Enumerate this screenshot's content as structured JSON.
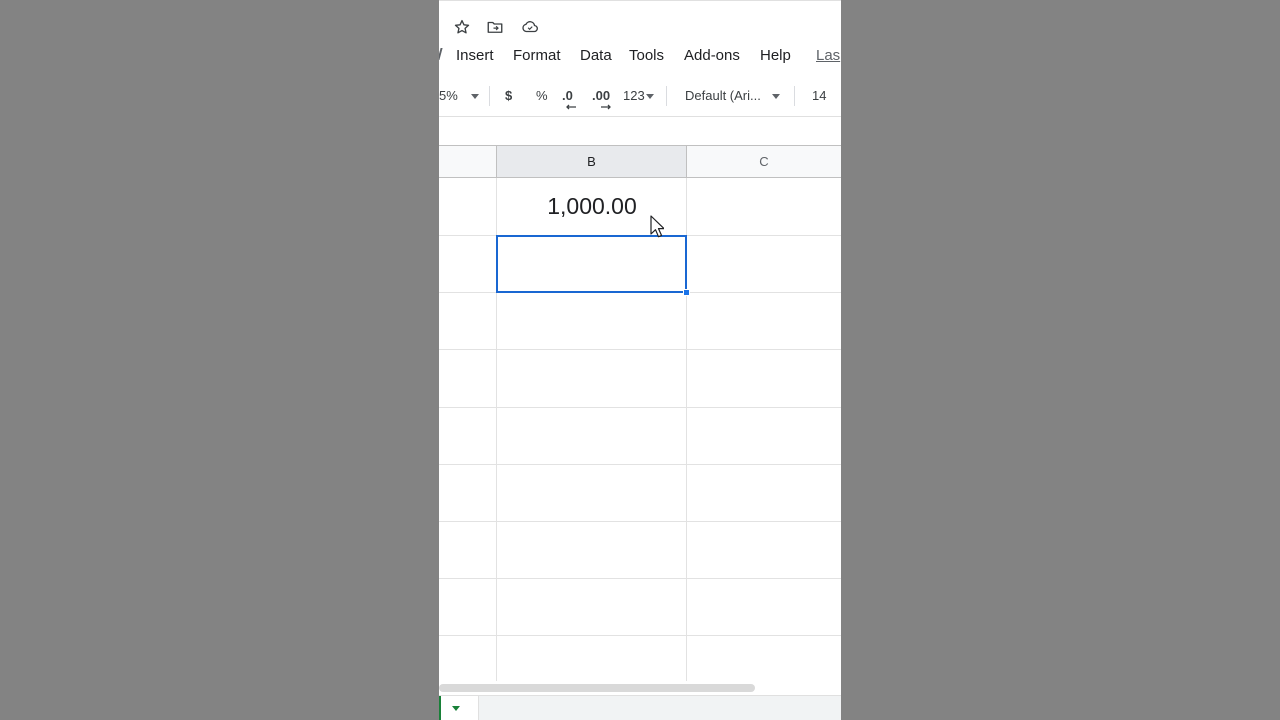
{
  "menubar": {
    "items": [
      "Insert",
      "Format",
      "Data",
      "Tools",
      "Add-ons",
      "Help"
    ],
    "last_edit_label": "Las"
  },
  "title_icons": [
    "star-icon",
    "move-to-folder-icon",
    "cloud-saved-icon"
  ],
  "toolbar": {
    "zoom": "5%",
    "currency": "$",
    "percent": "%",
    "decrease_decimals": ".0",
    "increase_decimals": ".00",
    "more_formats": "123",
    "font": "Default (Ari...",
    "font_size": "14"
  },
  "grid": {
    "columns": [
      "B",
      "C"
    ],
    "active_column": "B",
    "cells": {
      "B1": "1,000.00"
    }
  },
  "colors": {
    "selection": "#1a73e8",
    "sheet_tab_accent": "#188038",
    "background": "#838383"
  }
}
